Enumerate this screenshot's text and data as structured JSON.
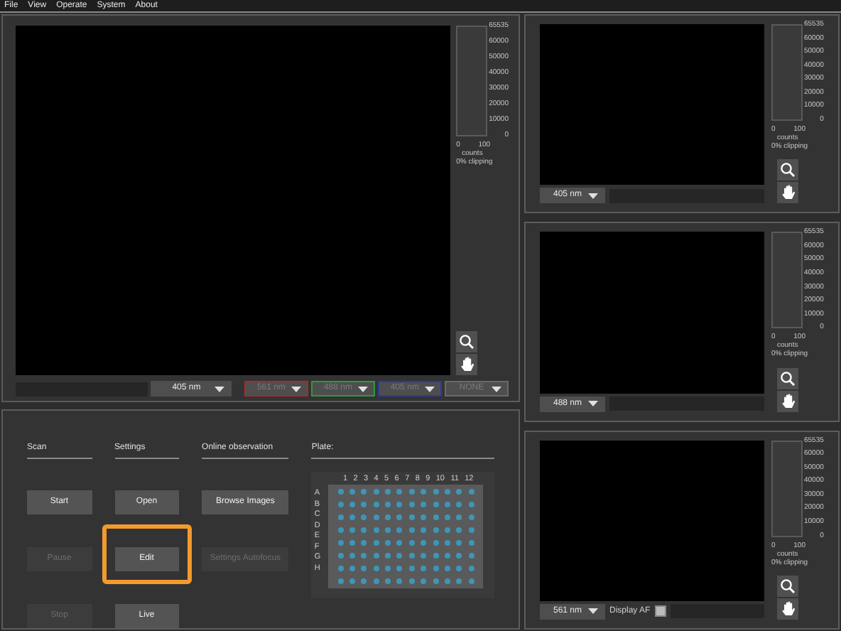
{
  "menu": [
    "File",
    "View",
    "Operate",
    "System",
    "About"
  ],
  "main_view": {
    "histogram": {
      "ticks": [
        "65535",
        "60000",
        "50000",
        "40000",
        "30000",
        "20000",
        "10000",
        "0"
      ],
      "x_min": "0",
      "x_max": "100",
      "units": "counts",
      "clipping": "0% clipping"
    },
    "channel": "405 nm",
    "overlays": [
      {
        "label": "561 nm",
        "color": "#b0282c"
      },
      {
        "label": "488 nm",
        "color": "#2f9a36"
      },
      {
        "label": "405 nm",
        "color": "#2e3aa0"
      },
      {
        "label": "NONE",
        "color": "#6a6a6a"
      }
    ]
  },
  "sections": [
    {
      "title": "Scan",
      "buttons": [
        {
          "label": "Start",
          "disabled": false,
          "highlighted": false
        },
        {
          "label": "Pause",
          "disabled": true,
          "highlighted": false
        },
        {
          "label": "Stop",
          "disabled": true,
          "highlighted": false
        }
      ]
    },
    {
      "title": "Settings",
      "buttons": [
        {
          "label": "Open",
          "disabled": false,
          "highlighted": false
        },
        {
          "label": "Edit",
          "disabled": false,
          "highlighted": true
        },
        {
          "label": "Live",
          "disabled": false,
          "highlighted": false
        }
      ]
    },
    {
      "title": "Online observation",
      "buttons": [
        {
          "label": "Browse Images",
          "disabled": false,
          "highlighted": false
        },
        {
          "label": "Settings Autofocus",
          "disabled": true,
          "highlighted": false
        }
      ]
    }
  ],
  "plate": {
    "title": "Plate:",
    "columns": [
      "1",
      "2",
      "3",
      "4",
      "5",
      "6",
      "7",
      "8",
      "9",
      "10",
      "11",
      "12"
    ],
    "rows": [
      "A",
      "B",
      "C",
      "D",
      "E",
      "F",
      "G",
      "H"
    ]
  },
  "side_views": [
    {
      "channel": "405 nm",
      "histogram": {
        "ticks": [
          "65535",
          "60000",
          "50000",
          "40000",
          "30000",
          "20000",
          "10000",
          "0"
        ],
        "x_min": "0",
        "x_max": "100",
        "units": "counts",
        "clipping": "0% clipping"
      }
    },
    {
      "channel": "488 nm",
      "histogram": {
        "ticks": [
          "65535",
          "60000",
          "50000",
          "40000",
          "30000",
          "20000",
          "10000",
          "0"
        ],
        "x_min": "0",
        "x_max": "100",
        "units": "counts",
        "clipping": "0% clipping"
      }
    },
    {
      "channel": "561 nm",
      "histogram": {
        "ticks": [
          "65535",
          "60000",
          "50000",
          "40000",
          "30000",
          "20000",
          "10000",
          "0"
        ],
        "x_min": "0",
        "x_max": "100",
        "units": "counts",
        "clipping": "0% clipping"
      },
      "display_af": {
        "label": "Display AF",
        "checked": false
      }
    }
  ]
}
